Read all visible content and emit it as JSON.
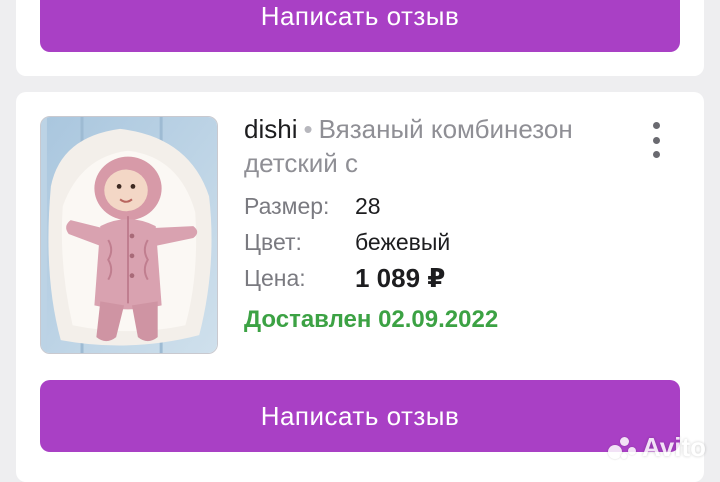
{
  "top_card": {
    "review_button": "Написать отзыв"
  },
  "order": {
    "seller": "dishi",
    "separator": "•",
    "product_title": "Вязаный комбинезон детский с",
    "attributes": [
      {
        "label": "Размер:",
        "value": "28"
      },
      {
        "label": "Цвет:",
        "value": "бежевый"
      },
      {
        "label": "Цена:",
        "value": "1 089 ₽"
      }
    ],
    "status": "Доставлен 02.09.2022",
    "review_button": "Написать отзыв"
  },
  "watermark": {
    "text": "Avito"
  },
  "colors": {
    "accent": "#a940c5",
    "status_green": "#3ca244",
    "page_background": "#eeeef0"
  },
  "icons": {
    "menu": "more-vertical-icon",
    "product_photo": "knitted-baby-jumpsuit-photo"
  }
}
